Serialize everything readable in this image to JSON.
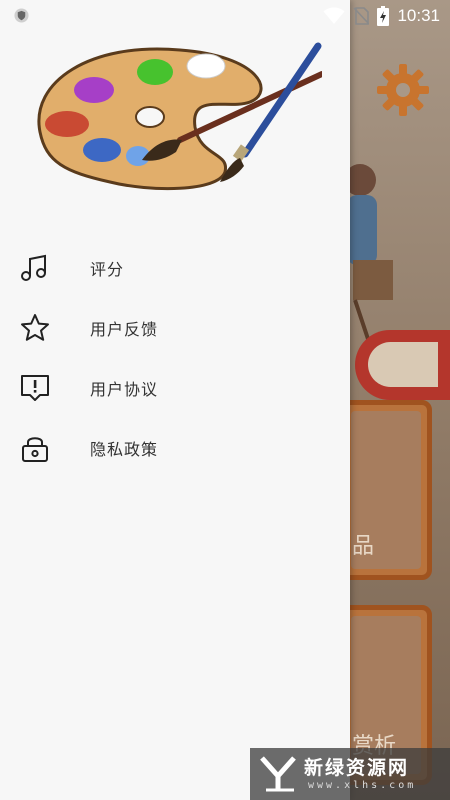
{
  "status_bar": {
    "time": "10:31",
    "icons": [
      "shield-notification-icon",
      "wifi-icon",
      "no-sim-icon",
      "battery-charging-icon"
    ]
  },
  "drawer": {
    "header_image": "paint-palette-illustration",
    "menu": [
      {
        "icon": "music-note-icon",
        "label": "评分"
      },
      {
        "icon": "star-icon",
        "label": "用户反馈"
      },
      {
        "icon": "alert-message-icon",
        "label": "用户协议"
      },
      {
        "icon": "lock-icon",
        "label": "隐私政策"
      }
    ]
  },
  "background": {
    "settings_icon": "gear-icon",
    "card_texts": [
      "品",
      "赏析"
    ],
    "accent_color": "#d87a2c"
  },
  "watermark": {
    "title": "新绿资源网",
    "url": "www.xlhs.com"
  }
}
